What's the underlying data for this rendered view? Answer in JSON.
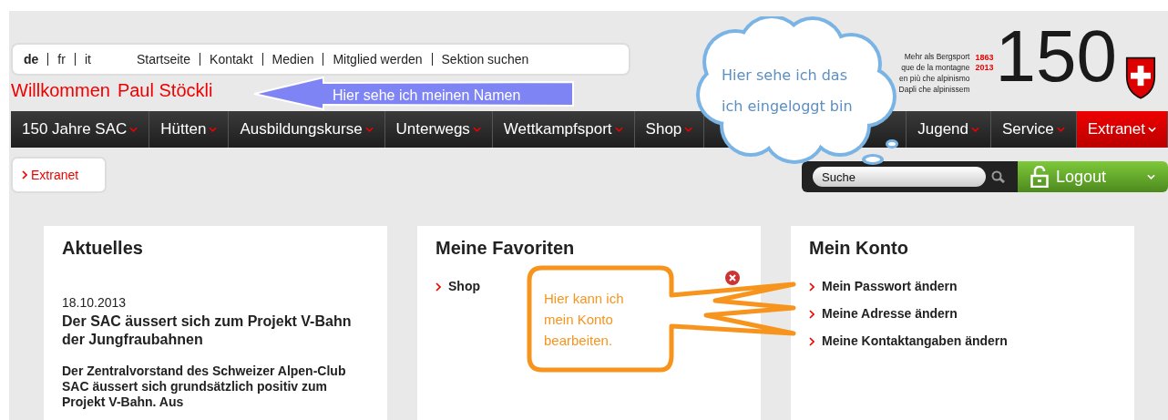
{
  "language_links": [
    {
      "label": "de",
      "selected": true
    },
    {
      "label": "fr",
      "selected": false
    },
    {
      "label": "it",
      "selected": false
    }
  ],
  "top_links": [
    "Startseite",
    "Kontakt",
    "Medien",
    "Mitglied werden",
    "Sektion suchen"
  ],
  "welcome": {
    "greeting": "Willkommen",
    "name": "Paul Stöckli"
  },
  "logo": {
    "taglines": [
      "Mehr als Bergsport",
      "que de la montagne",
      "en più che alpinismo",
      "Dapli che alpinissem"
    ],
    "years": [
      "1863",
      "2013"
    ],
    "number": "150"
  },
  "main_nav": {
    "left": [
      {
        "label": "150 Jahre SAC",
        "selected": false
      },
      {
        "label": "Hütten",
        "selected": false
      },
      {
        "label": "Ausbildungskurse",
        "selected": false
      },
      {
        "label": "Unterwegs",
        "selected": false
      },
      {
        "label": "Wettkampfsport",
        "selected": false
      },
      {
        "label": "Shop",
        "selected": false
      }
    ],
    "right": [
      {
        "label": "Jugend",
        "selected": false
      },
      {
        "label": "Service",
        "selected": false
      },
      {
        "label": "Extranet",
        "selected": true
      }
    ]
  },
  "breadcrumb": [
    "Extranet"
  ],
  "search": {
    "placeholder": "Suche"
  },
  "logout_button": "Logout",
  "panels": [
    {
      "kind": "news",
      "title": "Aktuelles",
      "date": "18.10.2013",
      "headline": "Der SAC äussert sich zum Projekt V-Bahn der Jungfraubahnen",
      "body": "Der Zentralvorstand des Schweizer Alpen-Club SAC äussert sich grundsätzlich positiv zum Projekt V-Bahn. Aus"
    },
    {
      "kind": "favorites",
      "title": "Meine Favoriten",
      "links": [
        "Shop"
      ]
    },
    {
      "kind": "links",
      "title": "Mein Konto",
      "links": [
        "Mein Passwort ändern",
        "Meine Adresse ändern",
        "Meine Kontaktangaben ändern"
      ]
    }
  ],
  "annotations": [
    {
      "kind": "arrow",
      "text": "Hier sehe ich meinen Namen"
    },
    {
      "kind": "cloud",
      "text": "Hier sehe ich das ich eingeloggt bin"
    },
    {
      "kind": "callout",
      "text": "Hier kann ich mein Konto bearbeiten."
    }
  ]
}
